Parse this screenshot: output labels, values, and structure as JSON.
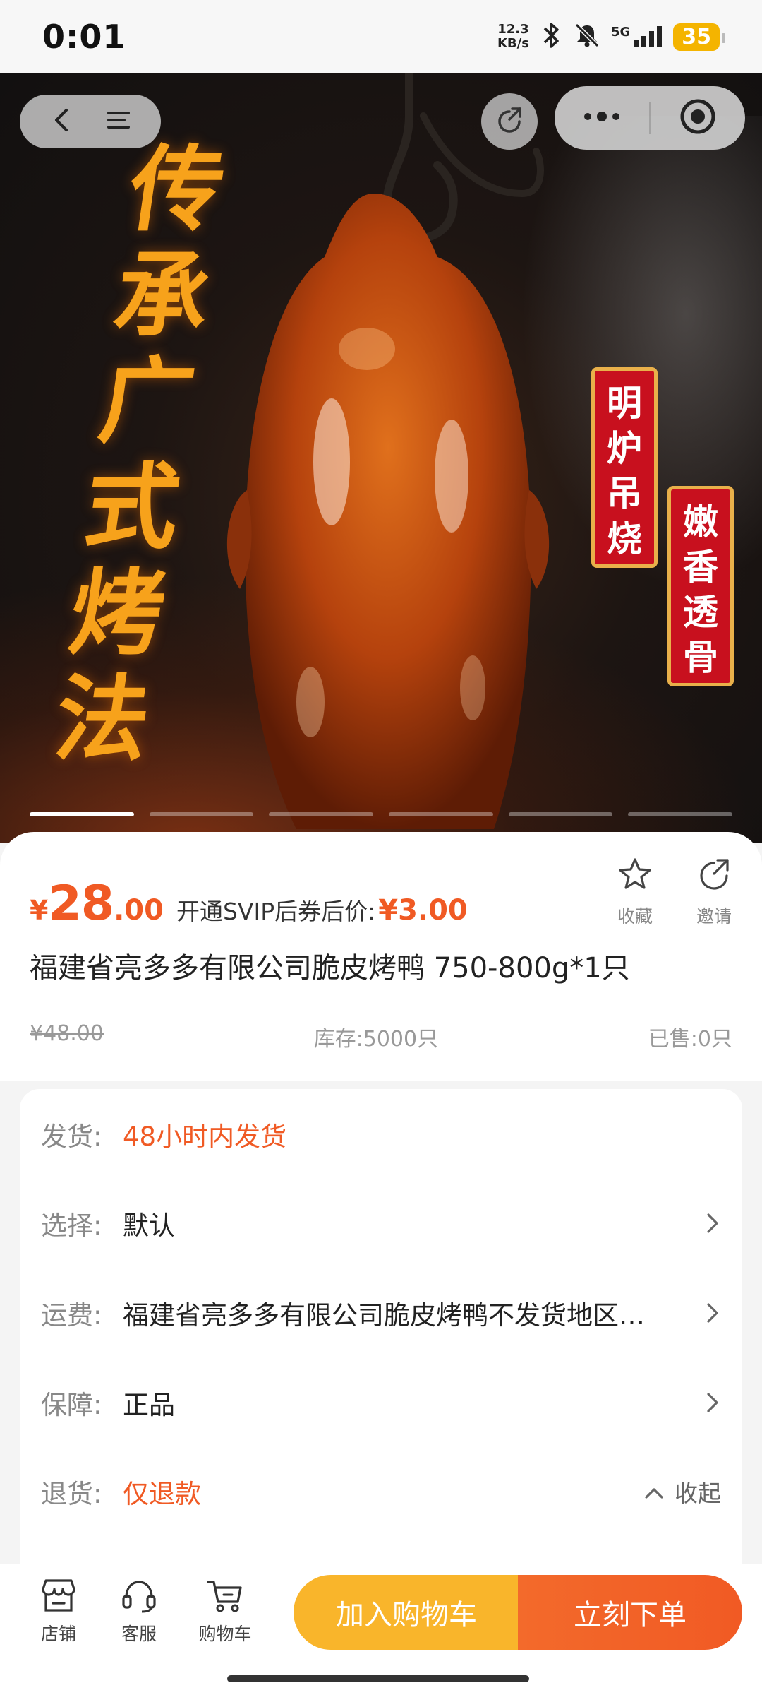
{
  "status_bar": {
    "time": "0:01",
    "net_speed_value": "12.3",
    "net_speed_unit": "KB/s",
    "network": "5G",
    "battery": "35"
  },
  "hero": {
    "title_chars": [
      "传",
      "承",
      "广",
      "式",
      "烤",
      "法"
    ],
    "tag1_chars": [
      "明",
      "炉",
      "吊",
      "烧"
    ],
    "tag2_chars": [
      "嫩",
      "香",
      "透",
      "骨"
    ],
    "carousel_count": 6,
    "carousel_active": 0
  },
  "product": {
    "price_symbol": "¥",
    "price_int": "28",
    "price_dec": ".00",
    "svip_label": "开通SVIP后券后价:",
    "svip_price": "¥3.00",
    "favorite_label": "收藏",
    "invite_label": "邀请",
    "title": "福建省亮多多有限公司脆皮烤鸭 750-800g*1只",
    "original_price": "¥48.00",
    "stock": "库存:5000只",
    "sold": "已售:0只"
  },
  "details": {
    "shipping": {
      "key": "发货:",
      "value": "48小时内发货"
    },
    "select": {
      "key": "选择:",
      "value": "默认"
    },
    "freight": {
      "key": "运费:",
      "value": "福建省亮多多有限公司脆皮烤鸭不发货地区…"
    },
    "guarantee": {
      "key": "保障:",
      "value": "正品"
    },
    "returns": {
      "key": "退货:",
      "value": "仅退款",
      "collapse_label": "收起"
    }
  },
  "bottom_bar": {
    "shop_label": "店铺",
    "service_label": "客服",
    "cart_label": "购物车",
    "add_to_cart": "加入购物车",
    "buy_now": "立刻下单"
  },
  "colors": {
    "accent": "#f05a24",
    "cart_button": "#f9b52b",
    "hero_title": "#f7a21b",
    "tag_red": "#c8101e"
  },
  "icons": [
    "back-icon",
    "menu-icon",
    "share-icon",
    "more-icon",
    "target-icon",
    "star-icon",
    "invite-icon",
    "chevron-right-icon",
    "chevron-up-icon",
    "shop-icon",
    "headset-icon",
    "cart-icon",
    "bluetooth-icon",
    "mute-bell-icon",
    "signal-icon",
    "battery-icon"
  ]
}
